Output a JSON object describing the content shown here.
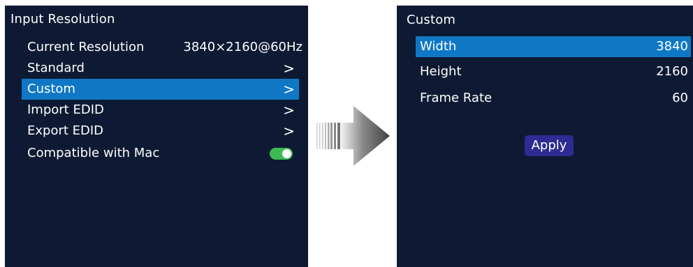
{
  "left_menu": {
    "title": "Input Resolution",
    "current_resolution_label": "Current Resolution",
    "current_resolution_value": "3840×2160@60Hz",
    "items": [
      {
        "label": "Standard",
        "chevron": ">"
      },
      {
        "label": "Custom",
        "chevron": ">"
      },
      {
        "label": "Import EDID",
        "chevron": ">"
      },
      {
        "label": "Export EDID",
        "chevron": ">"
      }
    ],
    "mac_compat": {
      "label": "Compatible with Mac",
      "enabled": true
    }
  },
  "right_menu": {
    "title": "Custom",
    "fields": [
      {
        "label": "Width",
        "value": "3840"
      },
      {
        "label": "Height",
        "value": "2160"
      },
      {
        "label": "Frame Rate",
        "value": "60"
      }
    ],
    "apply_label": "Apply"
  },
  "colors": {
    "panel_bg": "#0e1a33",
    "selection": "#0f78c6",
    "toggle_on": "#3dbb53",
    "apply_button": "#2e2c92"
  },
  "icons": [
    "chevron-right-icon",
    "toggle-switch-icon",
    "right-arrow-icon"
  ]
}
